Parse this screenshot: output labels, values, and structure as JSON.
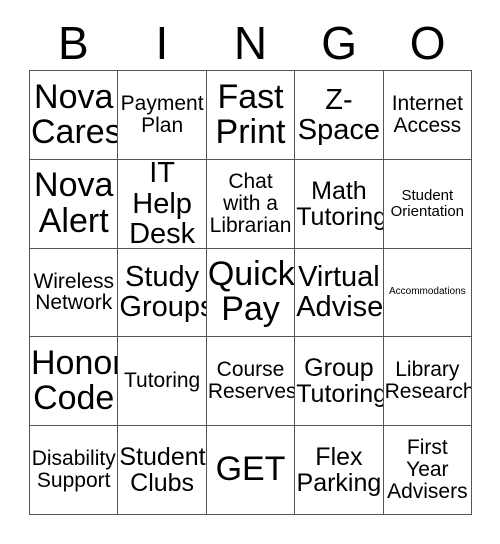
{
  "card": {
    "title": "BINGO",
    "header_letters": [
      "B",
      "I",
      "N",
      "G",
      "O"
    ],
    "colors": {
      "text": "#000000",
      "background": "#ffffff",
      "grid_line": "#555555"
    },
    "rows": [
      {
        "cells": [
          {
            "text": "Nova\nCares",
            "size": "fs-xxl"
          },
          {
            "text": "Payment\nPlan",
            "size": "fs-md"
          },
          {
            "text": "Fast\nPrint",
            "size": "fs-xxl"
          },
          {
            "text": "Z-\nSpace",
            "size": "fs-xl"
          },
          {
            "text": "Internet\nAccess",
            "size": "fs-md"
          }
        ]
      },
      {
        "cells": [
          {
            "text": "Nova\nAlert",
            "size": "fs-xxl"
          },
          {
            "text": "IT Help\nDesk",
            "size": "fs-xl"
          },
          {
            "text": "Chat\nwith a\nLibrarian",
            "size": "fs-md"
          },
          {
            "text": "Math\nTutoring",
            "size": "fs-lg"
          },
          {
            "text": "Student\nOrientation",
            "size": "fs-xs"
          }
        ]
      },
      {
        "cells": [
          {
            "text": "Wireless\nNetwork",
            "size": "fs-md"
          },
          {
            "text": "Study\nGroups",
            "size": "fs-xl"
          },
          {
            "text": "Quick\nPay",
            "size": "fs-xxl"
          },
          {
            "text": "Virtual\nAdviser",
            "size": "fs-xl"
          },
          {
            "text": "Accommodations",
            "size": "fs-xxs"
          }
        ]
      },
      {
        "cells": [
          {
            "text": "Honor\nCode",
            "size": "fs-xxl"
          },
          {
            "text": "Tutoring",
            "size": "fs-md"
          },
          {
            "text": "Course\nReserves",
            "size": "fs-md"
          },
          {
            "text": "Group\nTutoring",
            "size": "fs-lg"
          },
          {
            "text": "Library\nResearch",
            "size": "fs-md"
          }
        ]
      },
      {
        "cells": [
          {
            "text": "Disability\nSupport",
            "size": "fs-md"
          },
          {
            "text": "Student\nClubs",
            "size": "fs-lg"
          },
          {
            "text": "GET",
            "size": "fs-xxl"
          },
          {
            "text": "Flex\nParking",
            "size": "fs-lg"
          },
          {
            "text": "First\nYear\nAdvisers",
            "size": "fs-md"
          }
        ]
      }
    ]
  }
}
